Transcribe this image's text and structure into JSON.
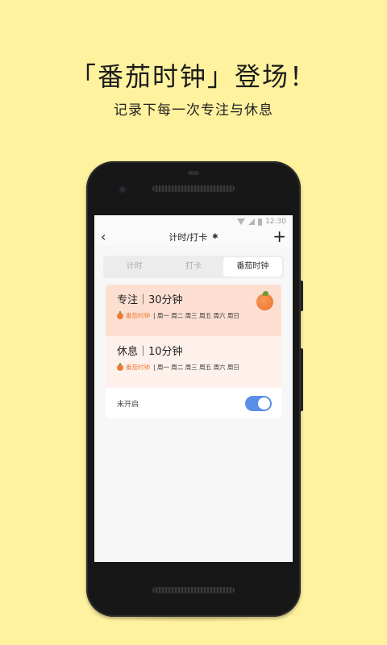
{
  "promo": {
    "headline": "「番茄时钟」登场！",
    "subline": "记录下每一次专注与休息"
  },
  "status_bar": {
    "time": "12:30",
    "icons": [
      "wifi-icon",
      "signal-icon",
      "battery-icon"
    ]
  },
  "app_bar": {
    "back_icon": "‹",
    "title": "计时/打卡",
    "bluetooth_icon": "✱",
    "add_icon": "+"
  },
  "tabs": [
    {
      "label": "计时",
      "active": false
    },
    {
      "label": "打卡",
      "active": false
    },
    {
      "label": "番茄时钟",
      "active": true
    }
  ],
  "sessions": [
    {
      "title": "专注｜30分钟",
      "tag": "番茄时钟",
      "days": "| 周一 周二 周三 周五 周六 周日",
      "color": "#fddfd2"
    },
    {
      "title": "休息｜10分钟",
      "tag": "番茄时钟",
      "days": "| 周一 周二 周三 周五 周六 周日",
      "color": "#fef1ec"
    }
  ],
  "toggle": {
    "label": "未开启",
    "on": true,
    "color": "#5b8ee6"
  },
  "colors": {
    "background": "#fff29f",
    "accent": "#f07a3a"
  }
}
